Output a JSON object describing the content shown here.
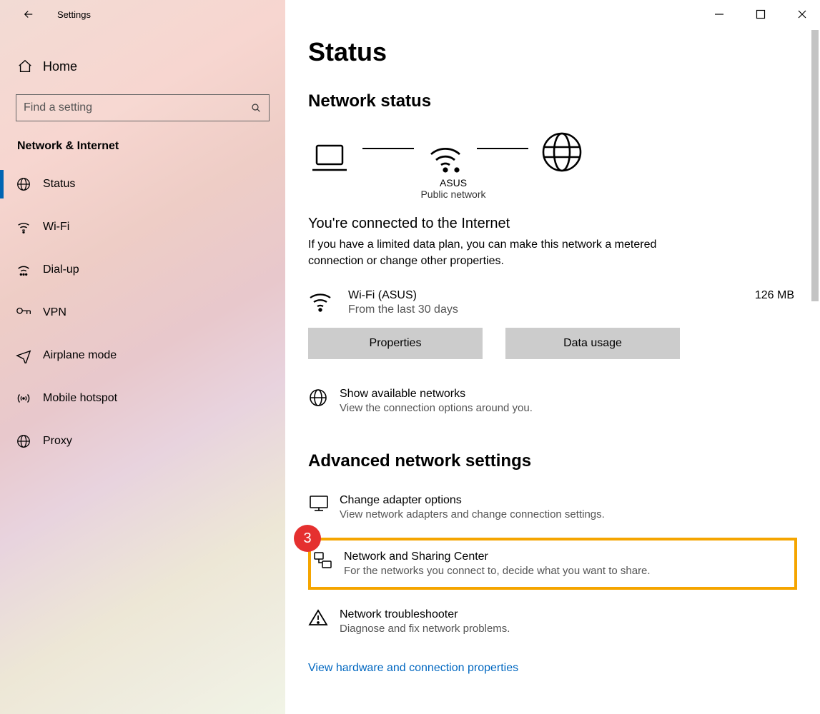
{
  "window": {
    "title": "Settings"
  },
  "sidebar": {
    "home": "Home",
    "search_placeholder": "Find a setting",
    "section": "Network & Internet",
    "items": [
      {
        "label": "Status",
        "selected": true
      },
      {
        "label": "Wi-Fi"
      },
      {
        "label": "Dial-up"
      },
      {
        "label": "VPN"
      },
      {
        "label": "Airplane mode"
      },
      {
        "label": "Mobile hotspot"
      },
      {
        "label": "Proxy"
      }
    ]
  },
  "main": {
    "title": "Status",
    "network_status_heading": "Network status",
    "diagram": {
      "ssid": "ASUS",
      "network_type": "Public network"
    },
    "connected_heading": "You're connected to the Internet",
    "connected_desc": "If you have a limited data plan, you can make this network a metered connection or change other properties.",
    "wifi": {
      "name": "Wi-Fi (ASUS)",
      "sub": "From the last 30 days",
      "usage": "126 MB"
    },
    "buttons": {
      "properties": "Properties",
      "data_usage": "Data usage"
    },
    "show_networks": {
      "title": "Show available networks",
      "sub": "View the connection options around you."
    },
    "advanced_heading": "Advanced network settings",
    "adapter": {
      "title": "Change adapter options",
      "sub": "View network adapters and change connection settings."
    },
    "sharing": {
      "title": "Network and Sharing Center",
      "sub": "For the networks you connect to, decide what you want to share."
    },
    "troubleshoot": {
      "title": "Network troubleshooter",
      "sub": "Diagnose and fix network problems."
    },
    "footer_link": "View hardware and connection properties",
    "step_badge": "3"
  }
}
